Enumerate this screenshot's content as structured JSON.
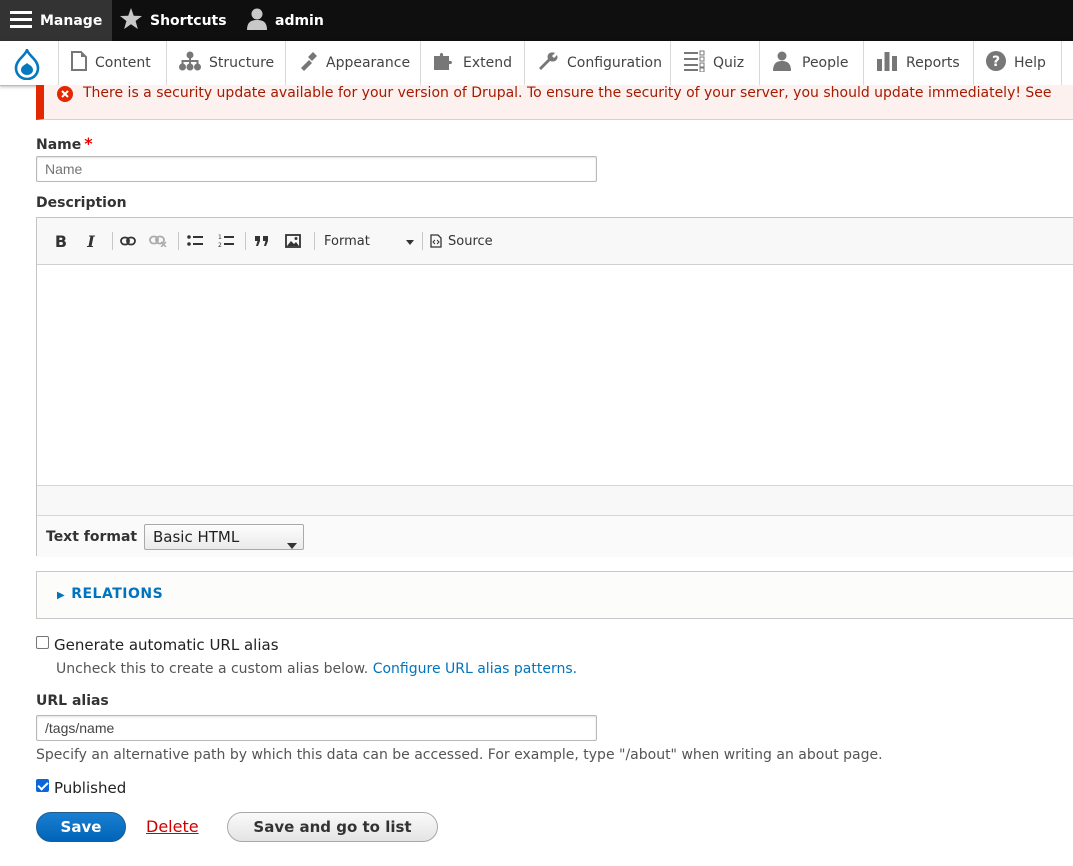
{
  "toolbar": {
    "manage": "Manage",
    "shortcuts": "Shortcuts",
    "user": "admin"
  },
  "menu": [
    {
      "label": "Content",
      "icon": "page-icon"
    },
    {
      "label": "Structure",
      "icon": "structure-icon"
    },
    {
      "label": "Appearance",
      "icon": "brush-icon"
    },
    {
      "label": "Extend",
      "icon": "puzzle-icon"
    },
    {
      "label": "Configuration",
      "icon": "wrench-icon"
    },
    {
      "label": "Quiz",
      "icon": "checklist-icon"
    },
    {
      "label": "People",
      "icon": "people-icon"
    },
    {
      "label": "Reports",
      "icon": "bar-chart-icon"
    },
    {
      "label": "Help",
      "icon": "help-icon"
    }
  ],
  "message": {
    "text": "There is a security update available for your version of Drupal. To ensure the security of your server, you should update immediately! See"
  },
  "form": {
    "name_label": "Name",
    "name_placeholder": "Name",
    "required_marker": "*",
    "description_label": "Description",
    "editor": {
      "format_label": "Format",
      "source_label": "Source"
    },
    "text_format_label": "Text format",
    "text_format_value": "Basic HTML",
    "relations_label": "RELATIONS",
    "auto_alias_label": "Generate automatic URL alias",
    "auto_alias_checked": false,
    "auto_alias_help": "Uncheck this to create a custom alias below.",
    "auto_alias_link": "Configure URL alias patterns.",
    "url_alias_label": "URL alias",
    "url_alias_value": "/tags/name",
    "url_alias_help": "Specify an alternative path by which this data can be accessed. For example, type \"/about\" when writing an about page.",
    "published_label": "Published",
    "published_checked": true
  },
  "actions": {
    "save": "Save",
    "delete": "Delete",
    "save_list": "Save and go to list"
  },
  "colors": {
    "primary": "#0074bd",
    "error": "#e32700",
    "toolbar": "#0f0f0f"
  }
}
